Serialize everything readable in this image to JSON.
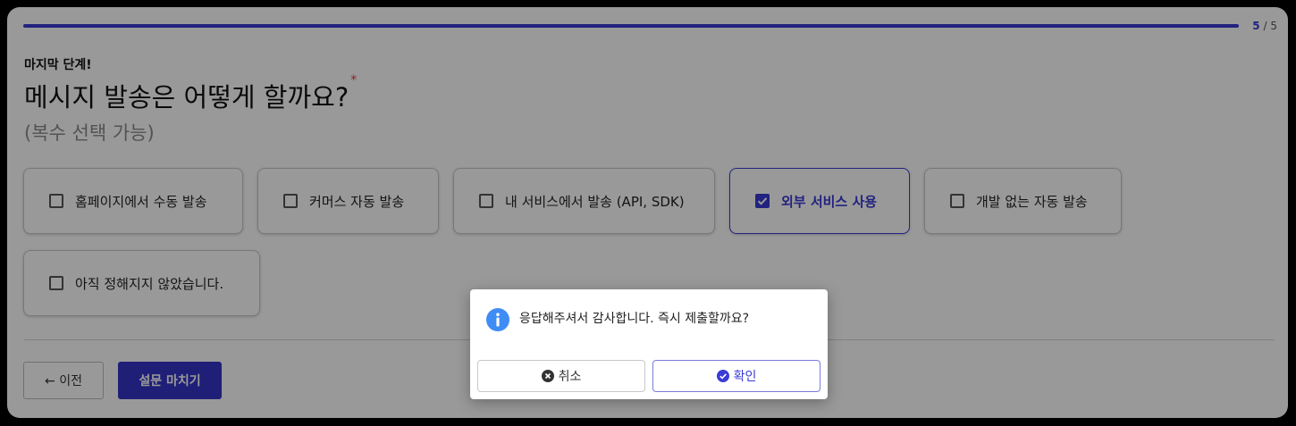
{
  "progress": {
    "current": "5",
    "separator": "/",
    "total": "5",
    "fraction": 1.0,
    "color": "#3a3ad6"
  },
  "step_label": "마지막 단계!",
  "question": "메시지 발송은 어떻게 할까요?",
  "required_mark": "*",
  "hint": "(복수 선택 가능)",
  "options": [
    {
      "label": "홈페이지에서 수동 발송",
      "checked": false
    },
    {
      "label": "커머스 자동 발송",
      "checked": false
    },
    {
      "label": "내 서비스에서 발송 (API, SDK)",
      "checked": false
    },
    {
      "label": "외부 서비스 사용",
      "checked": true
    },
    {
      "label": "개발 없는 자동 발송",
      "checked": false
    },
    {
      "label": "아직 정해지지 않았습니다.",
      "checked": false
    }
  ],
  "nav": {
    "prev_label": "← 이전",
    "finish_label": "설문 마치기"
  },
  "dialog": {
    "icon": "info-icon",
    "message": "응답해주셔서 감사합니다. 즉시 제출할까요?",
    "cancel_label": "취소",
    "cancel_icon": "close-circle-icon",
    "confirm_label": "확인",
    "confirm_icon": "check-circle-icon"
  },
  "colors": {
    "accent": "#3a3ad6",
    "info": "#3f8cf5"
  }
}
